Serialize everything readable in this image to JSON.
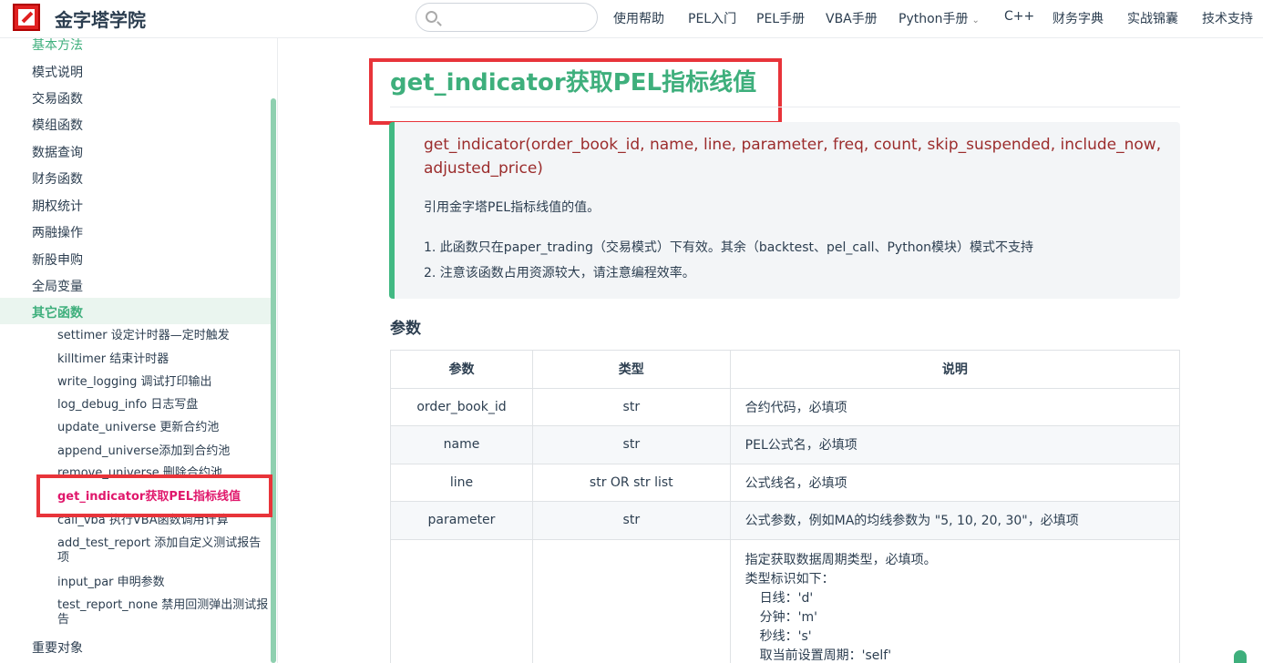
{
  "navbar": {
    "site_title": "金字塔学院",
    "search_placeholder": "",
    "items": [
      "使用帮助",
      "PEL入门",
      "PEL手册",
      "VBA手册",
      "Python手册",
      "C++",
      "财务字典",
      "实战锦囊",
      "技术支持"
    ]
  },
  "sidebar": {
    "top_items": [
      "基本方法",
      "模式说明",
      "交易函数",
      "模组函数",
      "数据查询",
      "财务函数",
      "期权统计",
      "两融操作",
      "新股申购",
      "全局变量"
    ],
    "active_group": "其它函数",
    "sub_items": [
      "settimer 设定计时器—定时触发",
      "killtimer 结束计时器",
      "write_logging 调试打印输出",
      "log_debug_info 日志写盘",
      "update_universe 更新合约池",
      "append_universe添加到合约池",
      "remove_universe 删除合约池",
      "get_indicator获取PEL指标线值",
      "call_vba 执行VBA函数调用计算",
      "add_test_report 添加自定义测试报告项",
      "input_par 申明参数",
      "test_report_none 禁用回测弹出测试报告"
    ],
    "bottom_item": "重要对象"
  },
  "main": {
    "title": "get_indicator获取PEL指标线值",
    "signature": "get_indicator(order_book_id, name, line, parameter, freq, count, skip_suspended, include_now, adjusted_price)",
    "description": "引用金字塔PEL指标线值的值。",
    "notes": [
      "1. 此函数只在paper_trading（交易模式）下有效。其余（backtest、pel_call、Python模块）模式不支持",
      "2. 注意该函数占用资源较大，请注意编程效率。"
    ],
    "section_heading": "参数",
    "table": {
      "headers": [
        "参数",
        "类型",
        "说明"
      ],
      "rows": [
        [
          "order_book_id",
          "str",
          "合约代码，必填项"
        ],
        [
          "name",
          "str",
          "PEL公式名，必填项"
        ],
        [
          "line",
          "str OR str list",
          "公式线名，必填项"
        ],
        [
          "parameter",
          "str",
          "公式参数，例如MA的均线参数为 \"5, 10, 20, 30\"，必填项"
        ]
      ],
      "freq_lines": [
        "指定获取数据周期类型，必填项。",
        "类型标识如下：",
        "日线：'d'",
        "分钟：'m'",
        "秒线：'s'",
        "取当前设置周期：'self'"
      ]
    }
  }
}
